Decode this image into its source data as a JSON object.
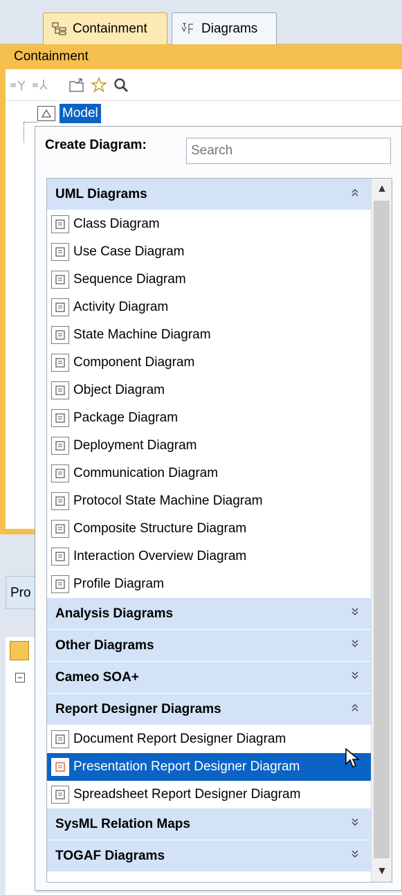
{
  "tabs": [
    {
      "label": "Containment",
      "icon": "containment-tree-icon",
      "active": true
    },
    {
      "label": "Diagrams",
      "icon": "diagrams-icon",
      "active": false
    }
  ],
  "panel": {
    "title": "Containment"
  },
  "toolbar": {
    "icons": [
      "collapse-all-icon",
      "expand-all-icon",
      "open-folder-icon",
      "favorite-star-icon",
      "search-icon"
    ]
  },
  "tree": {
    "root_label": "Model"
  },
  "bottom_panel": {
    "tab_label": "Pro"
  },
  "popup": {
    "title": "Create Diagram:",
    "search_placeholder": "Search",
    "groups": [
      {
        "label": "UML Diagrams",
        "expanded": true,
        "items": [
          {
            "label": "Class Diagram",
            "icon": "class-diagram-icon"
          },
          {
            "label": "Use Case Diagram",
            "icon": "use-case-diagram-icon"
          },
          {
            "label": "Sequence Diagram",
            "icon": "sequence-diagram-icon"
          },
          {
            "label": "Activity Diagram",
            "icon": "activity-diagram-icon"
          },
          {
            "label": "State Machine Diagram",
            "icon": "state-machine-diagram-icon"
          },
          {
            "label": "Component Diagram",
            "icon": "component-diagram-icon"
          },
          {
            "label": "Object Diagram",
            "icon": "object-diagram-icon"
          },
          {
            "label": "Package Diagram",
            "icon": "package-diagram-icon"
          },
          {
            "label": "Deployment Diagram",
            "icon": "deployment-diagram-icon"
          },
          {
            "label": "Communication Diagram",
            "icon": "communication-diagram-icon"
          },
          {
            "label": "Protocol State Machine Diagram",
            "icon": "protocol-state-machine-diagram-icon"
          },
          {
            "label": "Composite Structure Diagram",
            "icon": "composite-structure-diagram-icon"
          },
          {
            "label": "Interaction Overview Diagram",
            "icon": "interaction-overview-diagram-icon"
          },
          {
            "label": "Profile Diagram",
            "icon": "profile-diagram-icon"
          }
        ]
      },
      {
        "label": "Analysis Diagrams",
        "expanded": false,
        "items": []
      },
      {
        "label": "Other Diagrams",
        "expanded": false,
        "items": []
      },
      {
        "label": "Cameo SOA+",
        "expanded": false,
        "items": []
      },
      {
        "label": "Report Designer Diagrams",
        "expanded": true,
        "items": [
          {
            "label": "Document Report Designer Diagram",
            "icon": "document-report-icon"
          },
          {
            "label": "Presentation Report Designer Diagram",
            "icon": "presentation-report-icon",
            "selected": true
          },
          {
            "label": "Spreadsheet Report Designer Diagram",
            "icon": "spreadsheet-report-icon"
          }
        ]
      },
      {
        "label": "SysML Relation Maps",
        "expanded": false,
        "items": []
      },
      {
        "label": "TOGAF Diagrams",
        "expanded": false,
        "items": []
      }
    ]
  },
  "colors": {
    "accent_orange": "#f5bf4e",
    "group_header": "#d3e2f7",
    "selection_blue": "#0b63c5"
  }
}
